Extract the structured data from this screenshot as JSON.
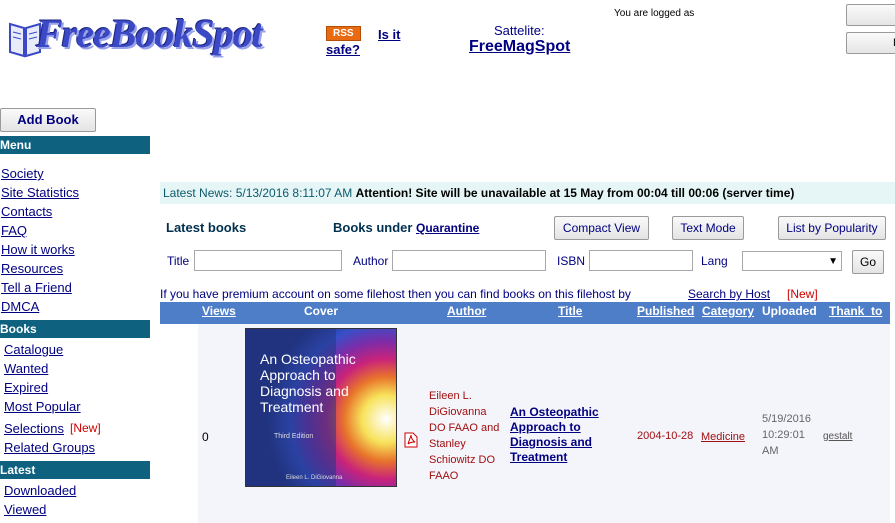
{
  "header": {
    "logo_text": "FreeBookSpot",
    "rss": "RSS",
    "safe_link": "safe?",
    "is_it_link": "Is it",
    "satellite_label": "Sattelite:",
    "satellite_link": "FreeMagSpot",
    "logged_in": "You are logged as",
    "btn_top_right": "",
    "btn_second_right": "R"
  },
  "sidebar": {
    "add_book": "Add Book",
    "menu_header": "Menu",
    "menu_items": [
      "Society",
      "Site Statistics",
      "Contacts",
      "FAQ",
      "How it works",
      "Resources",
      "Tell a Friend",
      "DMCA"
    ],
    "books_header": "Books",
    "books_items": [
      "Catalogue",
      "Wanted",
      "Expired",
      "Most Popular",
      "Selections",
      "Related Groups"
    ],
    "selections_new": "[New]",
    "latest_header": "Latest",
    "latest_items": [
      "Downloaded",
      "Viewed"
    ]
  },
  "news": {
    "prefix": "Latest News: 5/13/2016 8:11:07 AM",
    "message": "Attention! Site will be unavailable at 15 May from 00:04 till 00:06 (server time)"
  },
  "toolbar": {
    "latest_books": "Latest books",
    "quarantine_label": "Books under",
    "quarantine_link": "Quarantine",
    "compact_view": "Compact View",
    "text_mode": "Text Mode",
    "list_by_popularity": "List by Popularity"
  },
  "search": {
    "title_label": "Title",
    "title_value": "",
    "author_label": "Author",
    "author_value": "",
    "isbn_label": "ISBN",
    "isbn_value": "",
    "lang_label": "Lang",
    "lang_value": "",
    "go": "Go"
  },
  "premium": {
    "text": "If you have premium account on some filehost then you can find books on this filehost by",
    "link": "Search by Host",
    "new": "[New]"
  },
  "table": {
    "columns": [
      "Views",
      "Cover",
      "Author",
      "Title",
      "Published",
      "Category",
      "Uploaded",
      "Thank_to"
    ],
    "row": {
      "views": "0",
      "cover_title": "An Osteopathic Approach to Diagnosis and Treatment",
      "cover_edition": "Third Edition",
      "cover_author": "Eileen L. DiGiovanna",
      "author": "Eileen L. DiGiovanna DO FAAO and Stanley Schiowitz DO FAAO",
      "title": "An Osteopathic Approach to Diagnosis and Treatment",
      "published": "2004-10-28",
      "category": "Medicine",
      "uploaded": "5/19/2016 10:29:01 AM",
      "thank_to": "gestalt"
    }
  },
  "colors": {
    "sidebar_header": "#0e6280",
    "table_header": "#4f7ec9",
    "news_bg": "#e6f6f6",
    "link": "#000080",
    "accent_red": "#cc0000"
  }
}
